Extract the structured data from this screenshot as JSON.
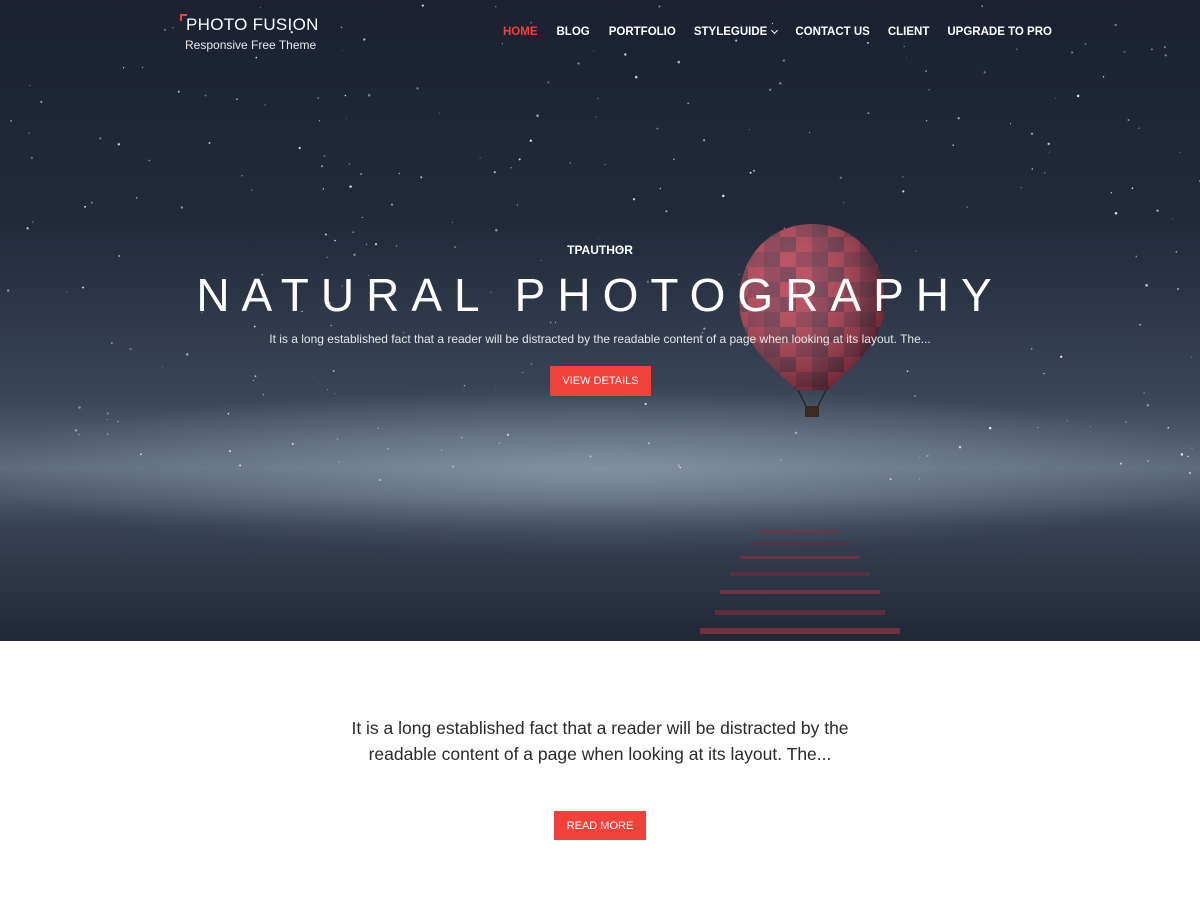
{
  "site": {
    "title": "PHOTO FUSION",
    "tagline": "Responsive Free Theme"
  },
  "nav": {
    "items": [
      {
        "label": "HOME",
        "active": true
      },
      {
        "label": "BLOG"
      },
      {
        "label": "PORTFOLIO"
      },
      {
        "label": "STYLEGUIDE",
        "has_dropdown": true
      },
      {
        "label": "CONTACT US"
      },
      {
        "label": "CLIENT"
      },
      {
        "label": "UPGRADE TO PRO"
      }
    ]
  },
  "hero": {
    "author": "TPAUTHOR",
    "title": "NATURAL PHOTOGRAPHY",
    "description": "It is a long established fact that a reader will be distracted by the readable content of a page when looking at its layout. The...",
    "button_label": "VIEW DETAILS"
  },
  "content": {
    "excerpt": "It is a long established fact that a reader will be distracted by the readable content of a page when looking at its layout. The...",
    "button_label": "READ MORE"
  },
  "colors": {
    "accent": "#f2403a",
    "hero_dark": "#1b2130",
    "text_dark": "#2a2a2a"
  },
  "icons": {
    "dropdown": "chevron-down-icon",
    "logo_mark": "corner-bracket-icon"
  }
}
